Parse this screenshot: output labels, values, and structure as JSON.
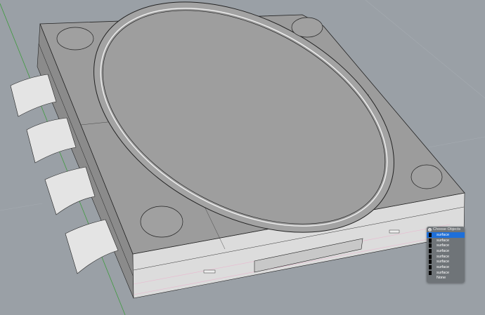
{
  "popup": {
    "title": "Choose Objects",
    "items": [
      "surface",
      "surface",
      "surface",
      "surface",
      "surface",
      "surface",
      "surface",
      "surface"
    ],
    "selected_index": 0,
    "none_label": "None"
  },
  "colors": {
    "background": "#9aa0a6",
    "selection": "#1e6fd9",
    "axis_green": "#3f9a3f"
  }
}
